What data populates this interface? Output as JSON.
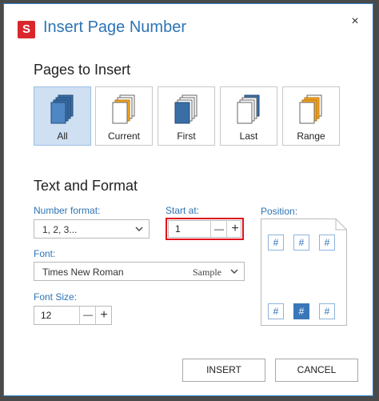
{
  "dialog": {
    "logo_letter": "S",
    "title": "Insert Page Number",
    "close_glyph": "×"
  },
  "pages_to_insert": {
    "heading": "Pages to Insert",
    "selected": "All",
    "options": [
      {
        "label": "All",
        "icon": "all-pages-icon"
      },
      {
        "label": "Current",
        "icon": "current-page-icon"
      },
      {
        "label": "First",
        "icon": "first-page-icon"
      },
      {
        "label": "Last",
        "icon": "last-page-icon"
      },
      {
        "label": "Range",
        "icon": "range-pages-icon"
      }
    ]
  },
  "text_and_format": {
    "heading": "Text and Format",
    "number_format": {
      "label": "Number format:",
      "value": "1, 2, 3..."
    },
    "start_at": {
      "label": "Start at:",
      "value": "1",
      "minus": "—",
      "plus": "+"
    },
    "font": {
      "label": "Font:",
      "value": "Times New Roman",
      "sample": "Sample"
    },
    "font_size": {
      "label": "Font Size:",
      "value": "12",
      "minus": "—",
      "plus": "+"
    },
    "position": {
      "label": "Position:",
      "glyph": "#",
      "selected": "bottom-center"
    }
  },
  "buttons": {
    "insert": "INSERT",
    "cancel": "CANCEL"
  },
  "colors": {
    "accent": "#2e74b5",
    "selected_bg": "#cfe0f3",
    "highlight": "#e0141e",
    "logo": "#d9262c"
  }
}
